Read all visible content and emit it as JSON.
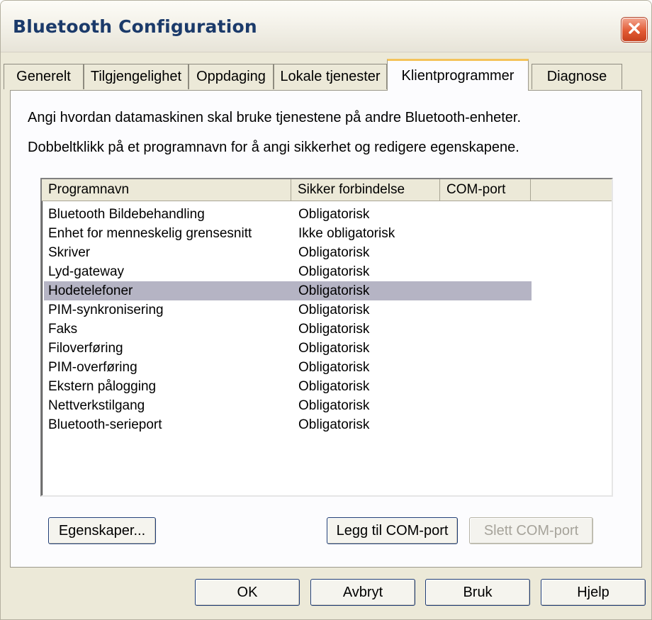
{
  "window": {
    "title": "Bluetooth Configuration"
  },
  "tabs": [
    {
      "label": "Generelt"
    },
    {
      "label": "Tilgjengelighet"
    },
    {
      "label": "Oppdaging"
    },
    {
      "label": "Lokale tjenester"
    },
    {
      "label": "Klientprogrammer",
      "active": true
    },
    {
      "label": "Diagnose"
    }
  ],
  "description": {
    "line1": "Angi hvordan datamaskinen skal bruke tjenestene på andre Bluetooth-enheter.",
    "line2": "Dobbeltklikk på et programnavn for å angi sikkerhet og redigere egenskapene."
  },
  "list": {
    "columns": [
      "Programnavn",
      "Sikker forbindelse",
      "COM-port"
    ],
    "rows": [
      {
        "name": "Bluetooth Bildebehandling",
        "secure": "Obligatorisk",
        "com": ""
      },
      {
        "name": "Enhet for menneskelig grensesnitt",
        "secure": "Ikke obligatorisk",
        "com": ""
      },
      {
        "name": "Skriver",
        "secure": "Obligatorisk",
        "com": ""
      },
      {
        "name": "Lyd-gateway",
        "secure": "Obligatorisk",
        "com": ""
      },
      {
        "name": "Hodetelefoner",
        "secure": "Obligatorisk",
        "com": "",
        "selected": true
      },
      {
        "name": "PIM-synkronisering",
        "secure": "Obligatorisk",
        "com": ""
      },
      {
        "name": "Faks",
        "secure": "Obligatorisk",
        "com": ""
      },
      {
        "name": "Filoverføring",
        "secure": "Obligatorisk",
        "com": ""
      },
      {
        "name": "PIM-overføring",
        "secure": "Obligatorisk",
        "com": ""
      },
      {
        "name": "Ekstern pålogging",
        "secure": "Obligatorisk",
        "com": ""
      },
      {
        "name": "Nettverkstilgang",
        "secure": "Obligatorisk",
        "com": ""
      },
      {
        "name": "Bluetooth-serieport",
        "secure": "Obligatorisk",
        "com": ""
      }
    ]
  },
  "panel_buttons": {
    "properties": "Egenskaper...",
    "add_com": "Legg til COM-port",
    "remove_com": "Slett COM-port"
  },
  "dialog_buttons": {
    "ok": "OK",
    "cancel": "Avbryt",
    "apply": "Bruk",
    "help": "Hjelp"
  },
  "colors": {
    "selection": "#b5b4c4",
    "active_tab_accent": "#f4c35a",
    "close_button": "#e25a34"
  },
  "icons": {
    "close": "close-icon"
  }
}
